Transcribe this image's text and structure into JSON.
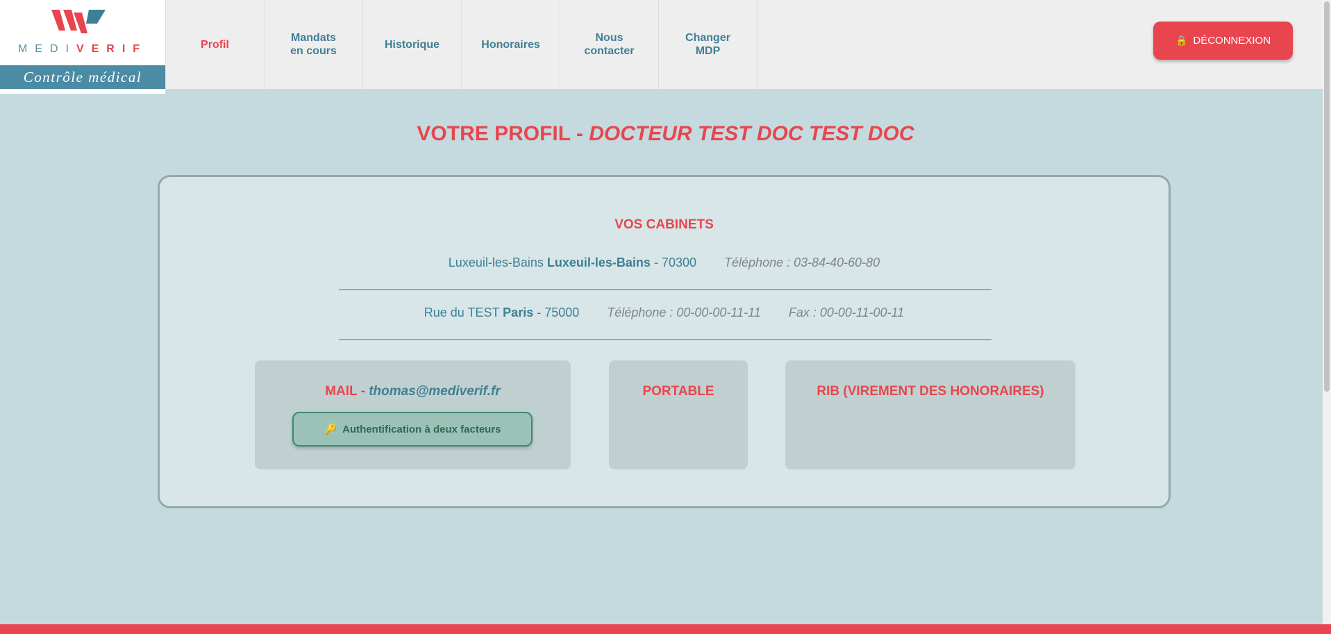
{
  "logo": {
    "medi": "MEDI",
    "verif": "VERIF",
    "tagline": "Contrôle médical"
  },
  "nav": {
    "items": [
      {
        "label": "Profil",
        "active": true
      },
      {
        "label": "Mandats\nen cours",
        "active": false
      },
      {
        "label": "Historique",
        "active": false
      },
      {
        "label": "Honoraires",
        "active": false
      },
      {
        "label": "Nous\ncontacter",
        "active": false
      },
      {
        "label": "Changer\nMDP",
        "active": false
      }
    ]
  },
  "logout": {
    "label": "DÉCONNEXION",
    "icon": "lock-icon"
  },
  "page": {
    "title_prefix": "VOTRE PROFIL - ",
    "title_name": "DOCTEUR TEST DOC TEST DOC"
  },
  "cabinets": {
    "title": "VOS CABINETS",
    "list": [
      {
        "address": "Luxeuil-les-Bains",
        "city": "Luxeuil-les-Bains",
        "postcode": " - 70300",
        "phone": "Téléphone : 03-84-40-60-80",
        "fax": ""
      },
      {
        "address": "Rue du TEST",
        "city": "Paris",
        "postcode": " - 75000",
        "phone": "Téléphone : 00-00-00-11-11",
        "fax": "Fax : 00-00-11-00-11"
      }
    ]
  },
  "mail": {
    "label": "MAIL - ",
    "value": "thomas@mediverif.fr",
    "twofa_label": "Authentification à deux facteurs",
    "twofa_icon": "key-icon"
  },
  "portable": {
    "label": "PORTABLE"
  },
  "rib": {
    "label": "RIB (VIREMENT DES HONORAIRES)"
  },
  "colors": {
    "accent": "#e8454f",
    "primary": "#3e7f96",
    "background": "#c5dade",
    "card": "#d8e6e7"
  }
}
